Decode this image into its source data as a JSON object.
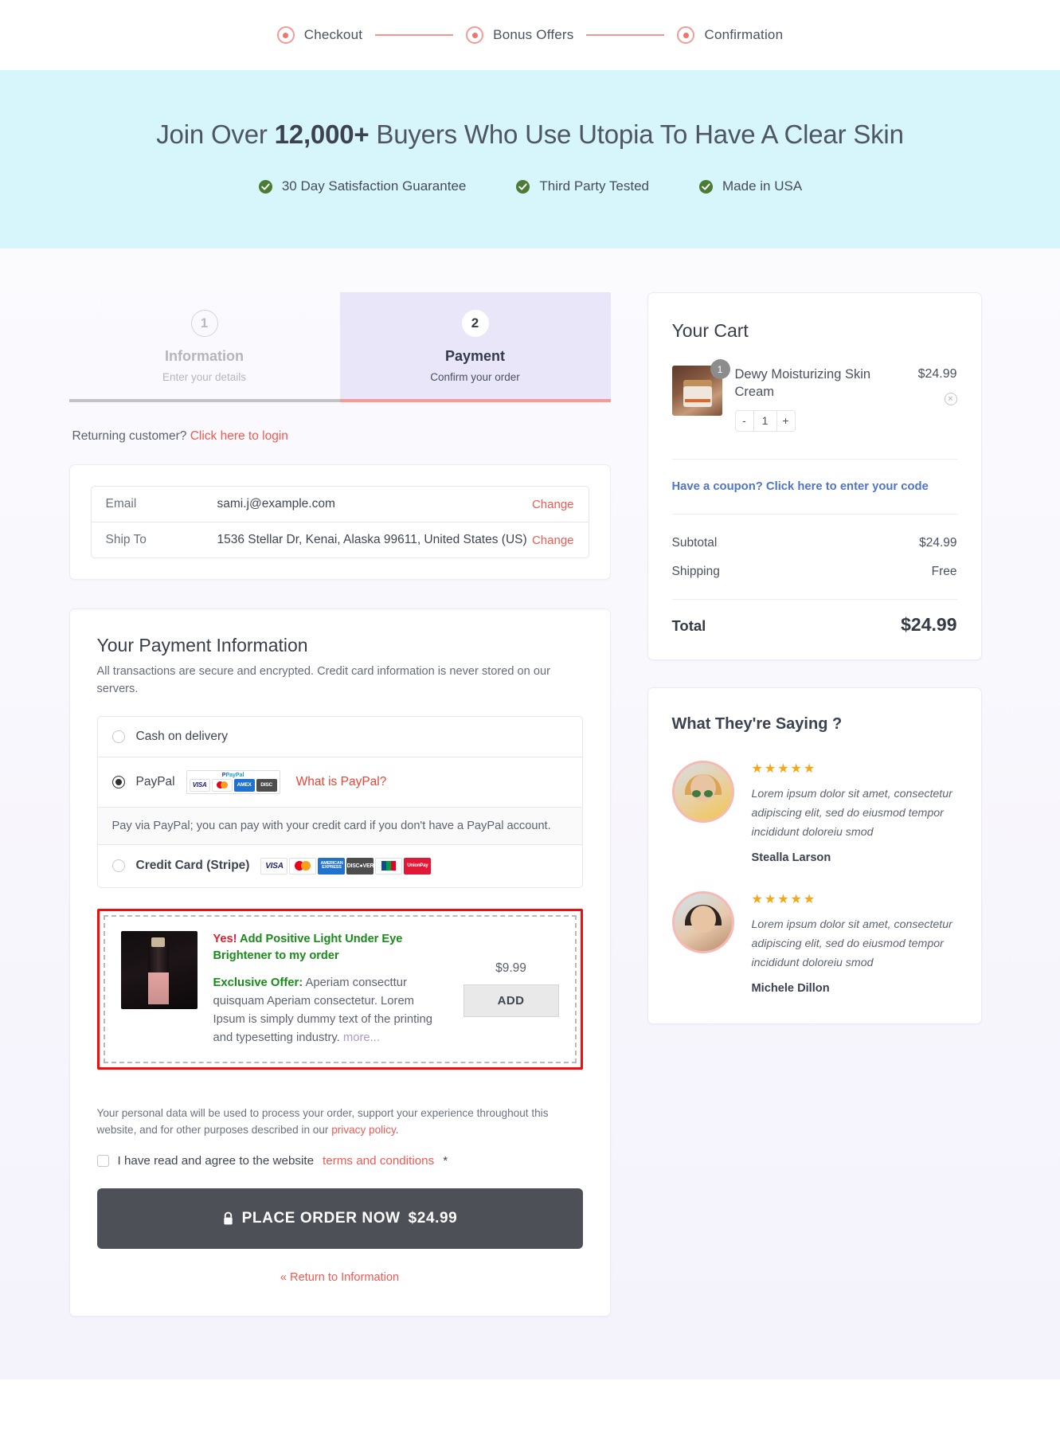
{
  "progress": {
    "steps": [
      {
        "label": "Checkout"
      },
      {
        "label": "Bonus Offers"
      },
      {
        "label": "Confirmation"
      }
    ]
  },
  "hero": {
    "title_before": "Join Over ",
    "title_highlight": "12,000+",
    "title_after": " Buyers Who Use Utopia To Have A Clear Skin",
    "badges": [
      {
        "label": "30 Day Satisfaction Guarantee"
      },
      {
        "label": "Third Party Tested"
      },
      {
        "label": "Made in USA"
      }
    ]
  },
  "checkout_steps": [
    {
      "number": "1",
      "title": "Information",
      "subtitle": "Enter your details",
      "state": "inactive"
    },
    {
      "number": "2",
      "title": "Payment",
      "subtitle": "Confirm your order",
      "state": "active"
    }
  ],
  "returning": {
    "text": "Returning customer?",
    "link": "Click here to login"
  },
  "info": {
    "rows": [
      {
        "label": "Email",
        "value": "sami.j@example.com",
        "action": "Change"
      },
      {
        "label": "Ship To",
        "value": "1536 Stellar Dr, Kenai, Alaska 99611, United States (US)",
        "action": "Change"
      }
    ]
  },
  "payment": {
    "title": "Your Payment Information",
    "description": "All transactions are secure and encrypted. Credit card information is never stored on our servers.",
    "methods": [
      {
        "label": "Cash on delivery",
        "selected": false
      },
      {
        "label": "PayPal",
        "selected": true,
        "link": "What is PayPal?"
      },
      {
        "label": "Credit Card (Stripe)",
        "selected": false
      }
    ],
    "paypal_note": "Pay via PayPal; you can pay with your credit card if you don't have a PayPal account.",
    "paypal_logo_top": "PayPal",
    "card_brands_paypal": [
      "VISA",
      "MasterCard",
      "AMEX",
      "DISCOVER"
    ],
    "card_brands_stripe": [
      "VISA",
      "mastercard",
      "AMERICAN EXPRESS",
      "DISCOVER",
      "JCB",
      "UnionPay"
    ]
  },
  "upsell": {
    "yes": "Yes!",
    "headline": "Add Positive Light Under Eye Brightener to my order",
    "offer_label": "Exclusive Offer:",
    "offer_text": " Aperiam consecttur quisquam Aperiam consectetur. Lorem Ipsum is simply dummy text of the printing and typesetting industry. ",
    "more": "more...",
    "price": "$9.99",
    "add_label": "ADD"
  },
  "legal": {
    "privacy_text": "Your personal data will be used to process your order, support your experience throughout this website, and for other purposes described in our ",
    "privacy_link": "privacy policy",
    "privacy_period": ".",
    "terms_before": "I have read and agree to the website ",
    "terms_link": "terms and conditions",
    "terms_after": " *"
  },
  "actions": {
    "place_order": "PLACE ORDER NOW",
    "place_order_amount": "$24.99",
    "return_link": "« Return to Information"
  },
  "cart": {
    "title": "Your Cart",
    "items": [
      {
        "name": "Dewy Moisturizing Skin Cream",
        "price": "$24.99",
        "qty": "1",
        "qty_badge": "1",
        "minus": "-",
        "plus": "+",
        "remove": "×"
      }
    ],
    "coupon": "Have a coupon? Click here to enter your code",
    "totals": [
      {
        "label": "Subtotal",
        "value": "$24.99"
      },
      {
        "label": "Shipping",
        "value": "Free"
      }
    ],
    "total_label": "Total",
    "total_value": "$24.99"
  },
  "testimonials": {
    "title": "What They're Saying ?",
    "items": [
      {
        "stars": "★★★★★",
        "quote": "Lorem ipsum dolor sit amet, consectetur adipiscing elit, sed do eiusmod tempor incididunt doloreiu smod",
        "name": "Stealla Larson"
      },
      {
        "stars": "★★★★★",
        "quote": "Lorem ipsum dolor sit amet, consectetur adipiscing elit, sed do eiusmod tempor incididunt doloreiu smod",
        "name": "Michele Dillon"
      }
    ]
  },
  "colors": {
    "accent_red": "#ef5a52",
    "hero_bg": "#d7f6fb",
    "active_step_bg": "#e9e6fa",
    "button_dark": "#4e5058",
    "green_check": "#4a7c34",
    "star": "#f7a618"
  }
}
